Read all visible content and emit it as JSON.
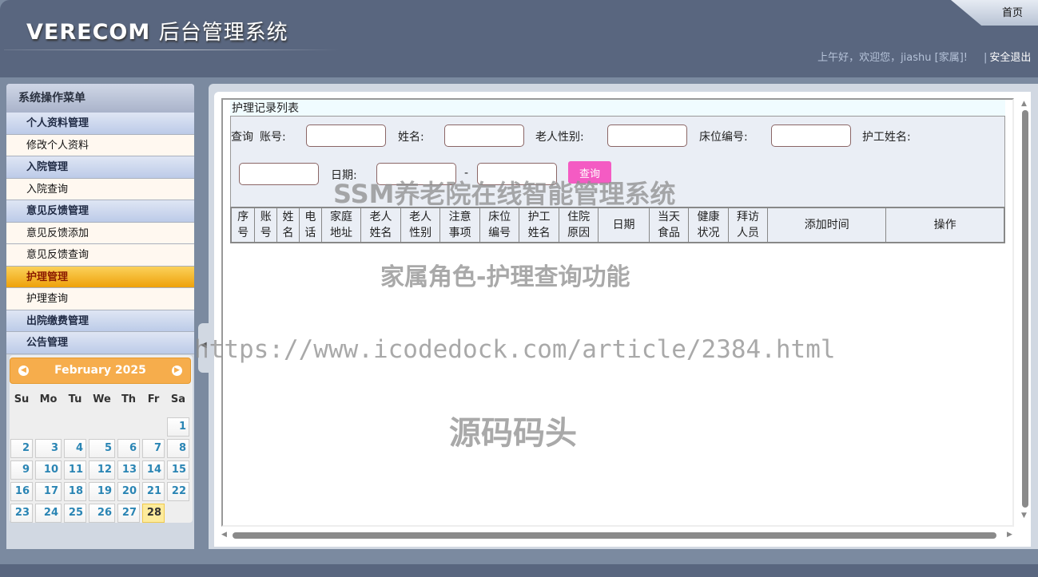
{
  "header": {
    "logo_en": "VERECOM",
    "logo_cn": "后台管理系统",
    "home": "首页",
    "greeting": "上午好，欢迎您，jiashu [家属]!",
    "logout": "安全退出"
  },
  "sidebar": {
    "title": "系统操作菜单",
    "items": [
      {
        "label": "个人资料管理",
        "type": "group"
      },
      {
        "label": "修改个人资料",
        "type": "sub"
      },
      {
        "label": "入院管理",
        "type": "group"
      },
      {
        "label": "入院查询",
        "type": "sub"
      },
      {
        "label": "意见反馈管理",
        "type": "group"
      },
      {
        "label": "意见反馈添加",
        "type": "sub"
      },
      {
        "label": "意见反馈查询",
        "type": "sub"
      },
      {
        "label": "护理管理",
        "type": "active"
      },
      {
        "label": "护理查询",
        "type": "sub"
      },
      {
        "label": "出院缴费管理",
        "type": "group"
      },
      {
        "label": "公告管理",
        "type": "group"
      }
    ]
  },
  "calendar": {
    "month": "February 2025",
    "weekdays": [
      "Su",
      "Mo",
      "Tu",
      "We",
      "Th",
      "Fr",
      "Sa"
    ],
    "first_weekday": 6,
    "days": 28,
    "today": 28,
    "accent": "#f6ad4c"
  },
  "main": {
    "title": "护理记录列表",
    "query_label": "查询",
    "fields": {
      "account": "账号:",
      "name": "姓名:",
      "gender": "老人性别:",
      "bed": "床位编号:",
      "nurse": "护工姓名:",
      "date": "日期:",
      "dash": "-"
    },
    "search_button": "查询",
    "columns": [
      [
        "序",
        "号"
      ],
      [
        "账",
        "号"
      ],
      [
        "姓",
        "名"
      ],
      [
        "电",
        "话"
      ],
      [
        "家庭",
        "地址"
      ],
      [
        "老人",
        "姓名"
      ],
      [
        "老人",
        "性别"
      ],
      [
        "注意",
        "事项"
      ],
      [
        "床位",
        "编号"
      ],
      [
        "护工",
        "姓名"
      ],
      [
        "住院",
        "原因"
      ],
      [
        "日期"
      ],
      [
        "当天",
        "食品"
      ],
      [
        "健康",
        "状况"
      ],
      [
        "拜访",
        "人员"
      ],
      [
        "添加时间"
      ],
      [
        "操作"
      ]
    ]
  },
  "watermarks": [
    "SSM养老院在线智能管理系统",
    "家属角色-护理查询功能",
    "https://www.icodedock.com/article/2384.html",
    "源码码头"
  ]
}
